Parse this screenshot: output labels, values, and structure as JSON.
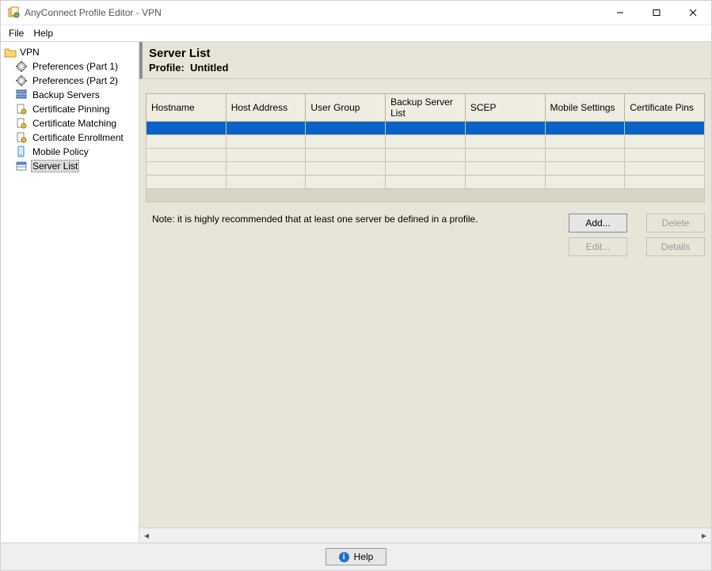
{
  "window": {
    "title": "AnyConnect Profile Editor - VPN"
  },
  "menu": {
    "file": "File",
    "help": "Help"
  },
  "tree": {
    "root": "VPN",
    "items": [
      {
        "label": "Preferences (Part 1)",
        "icon": "gear"
      },
      {
        "label": "Preferences (Part 2)",
        "icon": "gear"
      },
      {
        "label": "Backup Servers",
        "icon": "servers"
      },
      {
        "label": "Certificate Pinning",
        "icon": "cert"
      },
      {
        "label": "Certificate Matching",
        "icon": "cert"
      },
      {
        "label": "Certificate Enrollment",
        "icon": "cert"
      },
      {
        "label": "Mobile Policy",
        "icon": "mobile"
      },
      {
        "label": "Server List",
        "icon": "list",
        "selected": true
      }
    ]
  },
  "header": {
    "title": "Server List",
    "profile_label": "Profile:",
    "profile_name": "Untitled"
  },
  "table": {
    "columns": [
      "Hostname",
      "Host Address",
      "User Group",
      "Backup Server List",
      "SCEP",
      "Mobile Settings",
      "Certificate Pins"
    ],
    "rows": [
      {
        "selected": true,
        "cells": [
          "",
          "",
          "",
          "",
          "",
          "",
          ""
        ]
      },
      {
        "cells": [
          "",
          "",
          "",
          "",
          "",
          "",
          ""
        ]
      },
      {
        "cells": [
          "",
          "",
          "",
          "",
          "",
          "",
          ""
        ]
      },
      {
        "cells": [
          "",
          "",
          "",
          "",
          "",
          "",
          ""
        ]
      },
      {
        "cells": [
          "",
          "",
          "",
          "",
          "",
          "",
          ""
        ]
      }
    ]
  },
  "note": "Note: it is highly recommended that at least one server be defined in a profile.",
  "buttons": {
    "add": "Add...",
    "delete": "Delete",
    "edit": "Edit...",
    "details": "Details"
  },
  "footer": {
    "help": "Help"
  }
}
